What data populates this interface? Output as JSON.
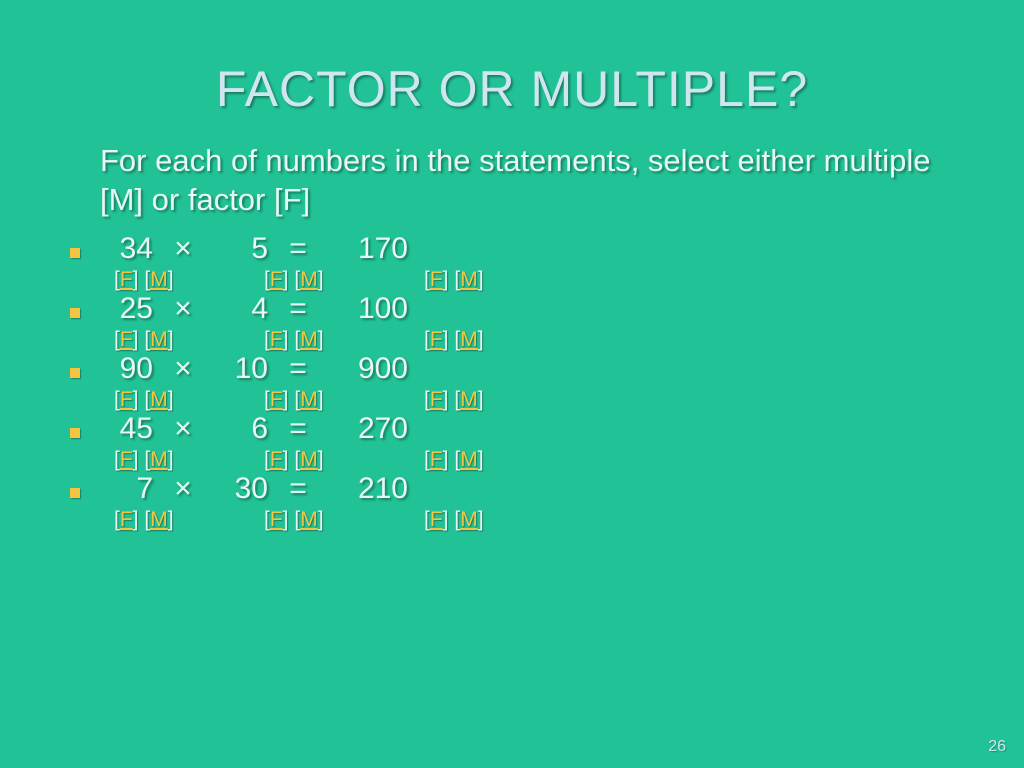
{
  "title": "FACTOR OR MULTIPLE?",
  "instruction": "For each of numbers in the statements, select either multiple [M] or factor [F]",
  "labels": {
    "F": "F",
    "M": "M",
    "times": "×",
    "equals": "="
  },
  "rows": [
    {
      "a": "34",
      "b": "5",
      "c": "170"
    },
    {
      "a": "25",
      "b": "4",
      "c": "100"
    },
    {
      "a": "90",
      "b": "10",
      "c": "900"
    },
    {
      "a": "45",
      "b": "6",
      "c": "270"
    },
    {
      "a": "7",
      "b": "30",
      "c": "210"
    }
  ],
  "page_number": "26"
}
